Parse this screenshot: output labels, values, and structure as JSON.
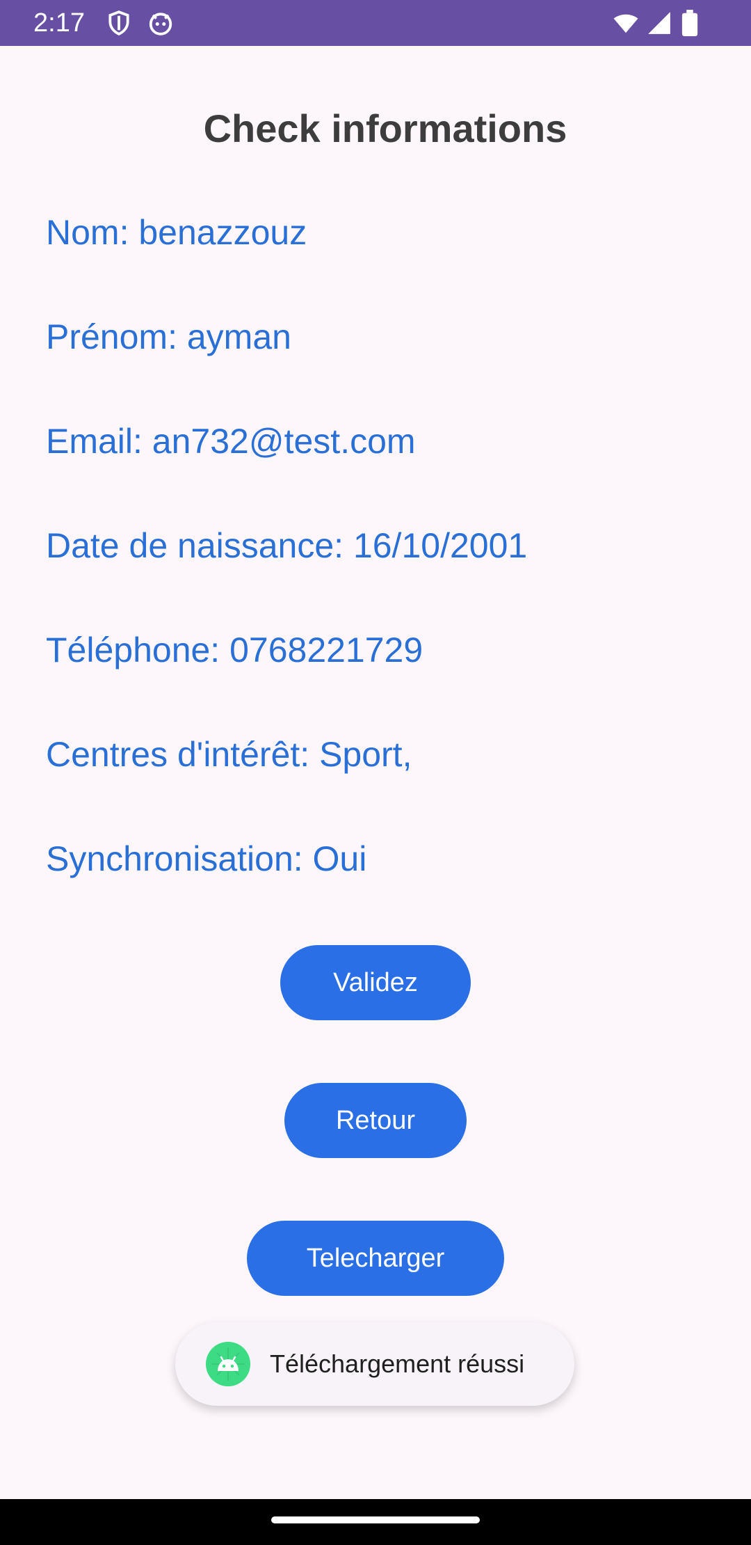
{
  "status_bar": {
    "time": "2:17",
    "icons": [
      "shield-icon",
      "android-face-icon",
      "wifi-icon",
      "signal-icon",
      "battery-icon"
    ],
    "background_color": "#6750a4"
  },
  "screen": {
    "title": "Check informations",
    "info_lines": [
      "Nom: benazzouz",
      "Prénom: ayman",
      "Email: an732@test.com",
      "Date de naissance: 16/10/2001",
      "Téléphone: 0768221729",
      "Centres d'intérêt: Sport,",
      "Synchronisation: Oui"
    ],
    "text_color": "#2a6fd6"
  },
  "buttons": {
    "validate_label": "Validez",
    "back_label": "Retour",
    "download_label": "Telecharger",
    "color": "#2a6fe6"
  },
  "toast": {
    "icon": "android-icon",
    "message": "Téléchargement réussi"
  }
}
